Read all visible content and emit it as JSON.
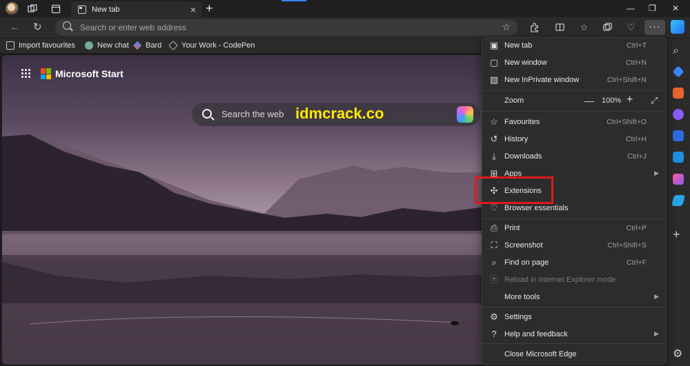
{
  "tab": {
    "title": "New tab"
  },
  "address": {
    "placeholder": "Search or enter web address"
  },
  "bookmarks": [
    {
      "label": "Import favourites"
    },
    {
      "label": "New chat"
    },
    {
      "label": "Bard"
    },
    {
      "label": "Your Work - CodePen"
    }
  ],
  "page": {
    "brand": "Microsoft Start",
    "search_placeholder": "Search the web",
    "watermark": "idmcrack.co"
  },
  "menu": {
    "items": [
      {
        "label": "New tab",
        "shortcut": "Ctrl+T",
        "icon": "new-tab-icon"
      },
      {
        "label": "New window",
        "shortcut": "Ctrl+N",
        "icon": "new-window-icon"
      },
      {
        "label": "New InPrivate window",
        "shortcut": "Ctrl+Shift+N",
        "icon": "inprivate-icon"
      },
      {
        "label": "Zoom",
        "shortcut": "",
        "icon": "zoom-icon"
      },
      {
        "label": "Favourites",
        "shortcut": "Ctrl+Shift+O",
        "icon": "favourites-icon"
      },
      {
        "label": "History",
        "shortcut": "Ctrl+H",
        "icon": "history-icon"
      },
      {
        "label": "Downloads",
        "shortcut": "Ctrl+J",
        "icon": "downloads-icon"
      },
      {
        "label": "Apps",
        "shortcut": "",
        "icon": "apps-icon"
      },
      {
        "label": "Extensions",
        "shortcut": "",
        "icon": "extensions-icon"
      },
      {
        "label": "Browser essentials",
        "shortcut": "",
        "icon": "essentials-icon"
      },
      {
        "label": "Print",
        "shortcut": "Ctrl+P",
        "icon": "print-icon"
      },
      {
        "label": "Screenshot",
        "shortcut": "Ctrl+Shift+S",
        "icon": "screenshot-icon"
      },
      {
        "label": "Find on page",
        "shortcut": "Ctrl+F",
        "icon": "find-icon"
      },
      {
        "label": "Reload in Internet Explorer mode",
        "shortcut": "",
        "icon": "ie-mode-icon"
      },
      {
        "label": "More tools",
        "shortcut": "",
        "icon": "more-tools-icon"
      },
      {
        "label": "Settings",
        "shortcut": "",
        "icon": "settings-icon"
      },
      {
        "label": "Help and feedback",
        "shortcut": "",
        "icon": "help-icon"
      },
      {
        "label": "Close Microsoft Edge",
        "shortcut": "",
        "icon": "close-edge-icon"
      }
    ],
    "zoom_value": "100%"
  },
  "colors": {
    "highlight": "#e01b1b",
    "accent": "#3a86ff",
    "watermark": "#ffeb00"
  }
}
